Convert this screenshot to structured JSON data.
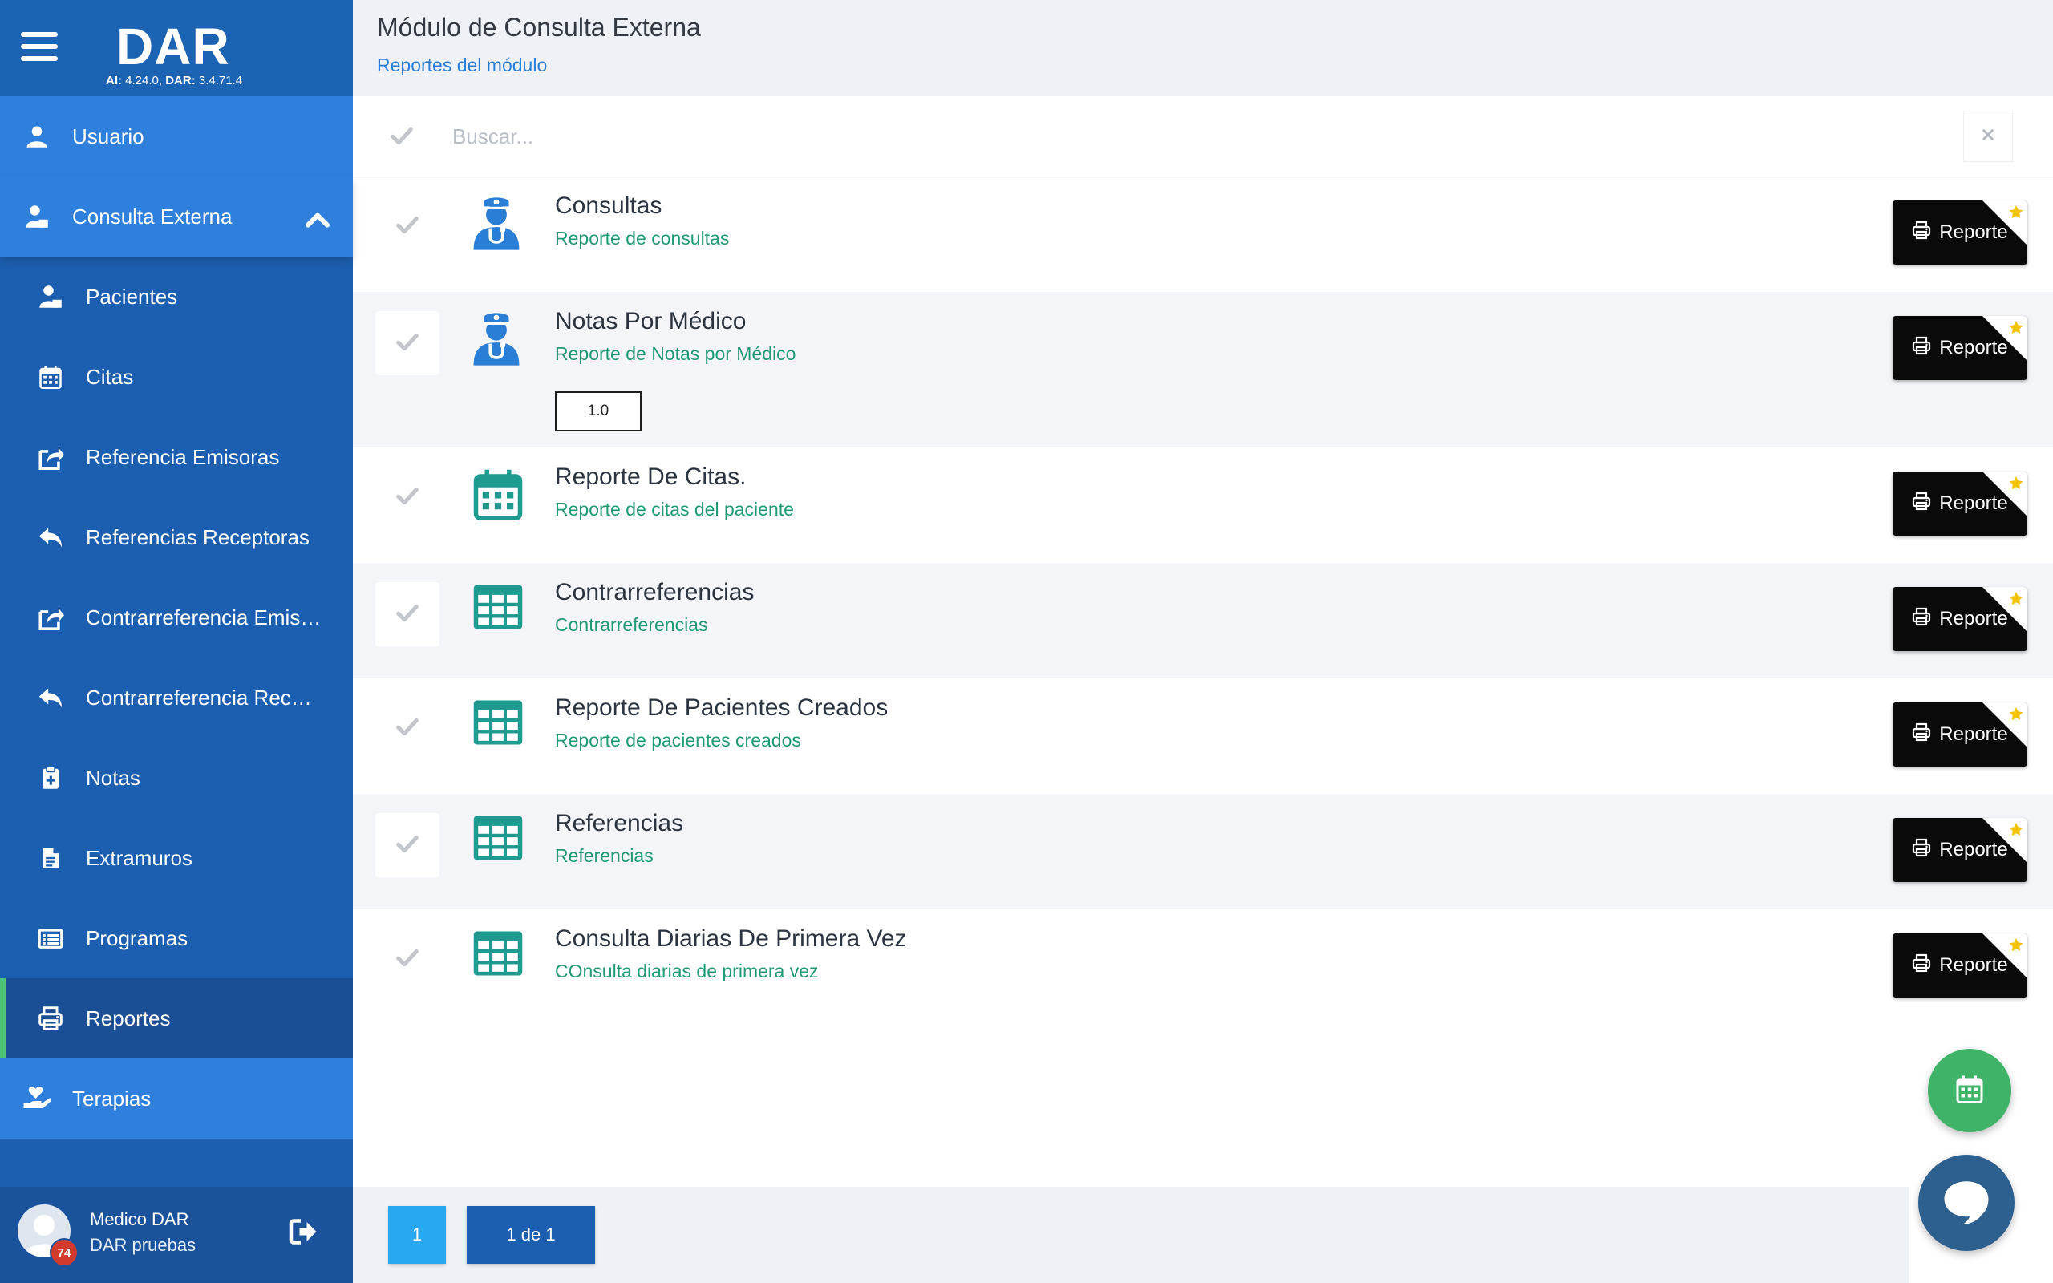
{
  "app": {
    "logo": "DAR",
    "version_ai_label": "AI:",
    "version_ai": "4.24.0,",
    "version_dar_label": "DAR:",
    "version_dar": "3.4.71.4"
  },
  "sidebar": {
    "top_items": [
      {
        "label": "Usuario",
        "icon": "user-icon"
      },
      {
        "label": "Consulta Externa",
        "icon": "user-doctor-icon",
        "expanded": true
      }
    ],
    "sub_items": [
      {
        "label": "Pacientes",
        "icon": "patient-icon"
      },
      {
        "label": "Citas",
        "icon": "calendar-icon"
      },
      {
        "label": "Referencia Emisoras",
        "icon": "share-out-icon"
      },
      {
        "label": "Referencias Receptoras",
        "icon": "reply-icon"
      },
      {
        "label": "Contrarreferencia Emis…",
        "icon": "share-out-icon"
      },
      {
        "label": "Contrarreferencia Rec…",
        "icon": "reply-icon"
      },
      {
        "label": "Notas",
        "icon": "clipboard-medical-icon"
      },
      {
        "label": "Extramuros",
        "icon": "document-icon"
      },
      {
        "label": "Programas",
        "icon": "list-icon"
      },
      {
        "label": "Reportes",
        "icon": "printer-icon",
        "active": true
      }
    ],
    "bottom_item": {
      "label": "Terapias",
      "icon": "hand-heart-icon"
    },
    "user": {
      "name": "Medico DAR",
      "org": "DAR pruebas",
      "badge": "74"
    }
  },
  "header": {
    "title": "Módulo de Consulta Externa",
    "subtitle": "Reportes del módulo"
  },
  "search": {
    "placeholder": "Buscar..."
  },
  "reports": [
    {
      "title": "Consultas",
      "desc": "Reporte de consultas",
      "icon": "doctor-icon",
      "button": "Reporte"
    },
    {
      "title": "Notas Por Médico",
      "desc": "Reporte de Notas por Médico",
      "icon": "doctor-icon",
      "button": "Reporte",
      "version": "1.0"
    },
    {
      "title": "Reporte De Citas.",
      "desc": "Reporte de citas del paciente",
      "icon": "calendar-icon",
      "button": "Reporte"
    },
    {
      "title": "Contrarreferencias",
      "desc": "Contrarreferencias",
      "icon": "table-icon",
      "button": "Reporte"
    },
    {
      "title": "Reporte De Pacientes Creados",
      "desc": "Reporte de pacientes creados",
      "icon": "table-icon",
      "button": "Reporte"
    },
    {
      "title": "Referencias",
      "desc": "Referencias",
      "icon": "table-icon",
      "button": "Reporte"
    },
    {
      "title": "Consulta Diarias De Primera Vez",
      "desc": "COnsulta diarias de primera vez",
      "icon": "table-icon",
      "button": "Reporte"
    }
  ],
  "pagination": {
    "current": "1",
    "info": "1 de 1"
  },
  "colors": {
    "sidebar": "#1c5fb0",
    "sidebar_top": "#2f7fdc",
    "active_indicator": "#4ec276",
    "icon_blue": "#2a7ed6",
    "icon_teal": "#1f9a8f",
    "desc_green": "#1f9a74",
    "star": "#f2c200",
    "fab_green": "#3fb469",
    "fab_chat": "#2d5f8f"
  }
}
